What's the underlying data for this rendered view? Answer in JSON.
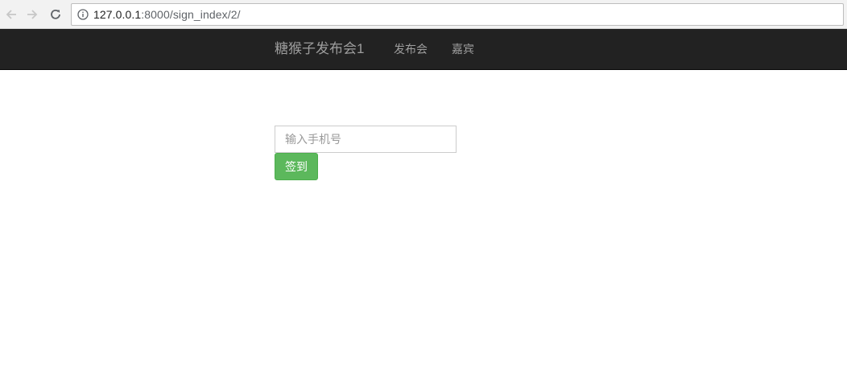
{
  "browser": {
    "url_host": "127.0.0.1",
    "url_rest": ":8000/sign_index/2/",
    "icons": {
      "back": "arrow-left-icon",
      "forward": "arrow-right-icon",
      "reload": "reload-icon",
      "info": "info-icon"
    }
  },
  "navbar": {
    "brand": "糖猴子发布会1",
    "links": [
      {
        "label": "发布会"
      },
      {
        "label": "嘉宾"
      }
    ]
  },
  "sign_form": {
    "phone_placeholder": "输入手机号",
    "phone_value": "",
    "submit_label": "签到"
  },
  "colors": {
    "navbar_bg": "#222222",
    "navbar_text": "#9d9d9d",
    "button_success": "#5cb85c"
  }
}
